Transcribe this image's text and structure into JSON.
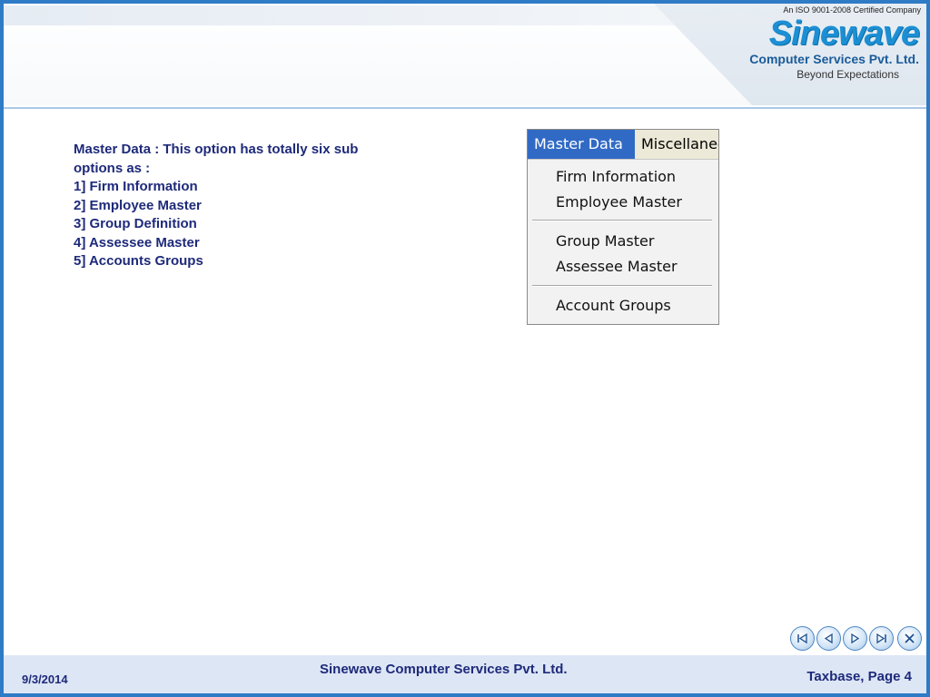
{
  "header": {
    "logo": {
      "iso": "An ISO 9001-2008 Certified Company",
      "brand": "Sinewave",
      "company": "Computer Services Pvt. Ltd.",
      "tagline": "Beyond Expectations"
    }
  },
  "content": {
    "lines": [
      "Master Data : This option has totally six sub",
      "options as :",
      "1] Firm Information",
      "2] Employee Master",
      "3] Group Definition",
      "4] Assessee Master",
      "5] Accounts Groups"
    ]
  },
  "menu": {
    "bar": [
      "Master Data",
      "Miscellaneo"
    ],
    "items": [
      "Firm Information",
      "Employee Master",
      "Group Master",
      "Assessee Master",
      "Account Groups"
    ]
  },
  "nav": {
    "buttons": [
      "first-icon",
      "previous-icon",
      "next-icon",
      "last-icon",
      "close-icon"
    ]
  },
  "footer": {
    "date": "9/3/2014",
    "company": "Sinewave Computer Services Pvt. Ltd.",
    "page": "Taxbase, Page 4"
  },
  "colors": {
    "frame": "#2f7bc6",
    "text": "#1e2a7a",
    "menu_highlight": "#316ac5",
    "footer_bg": "#dde6f5"
  }
}
